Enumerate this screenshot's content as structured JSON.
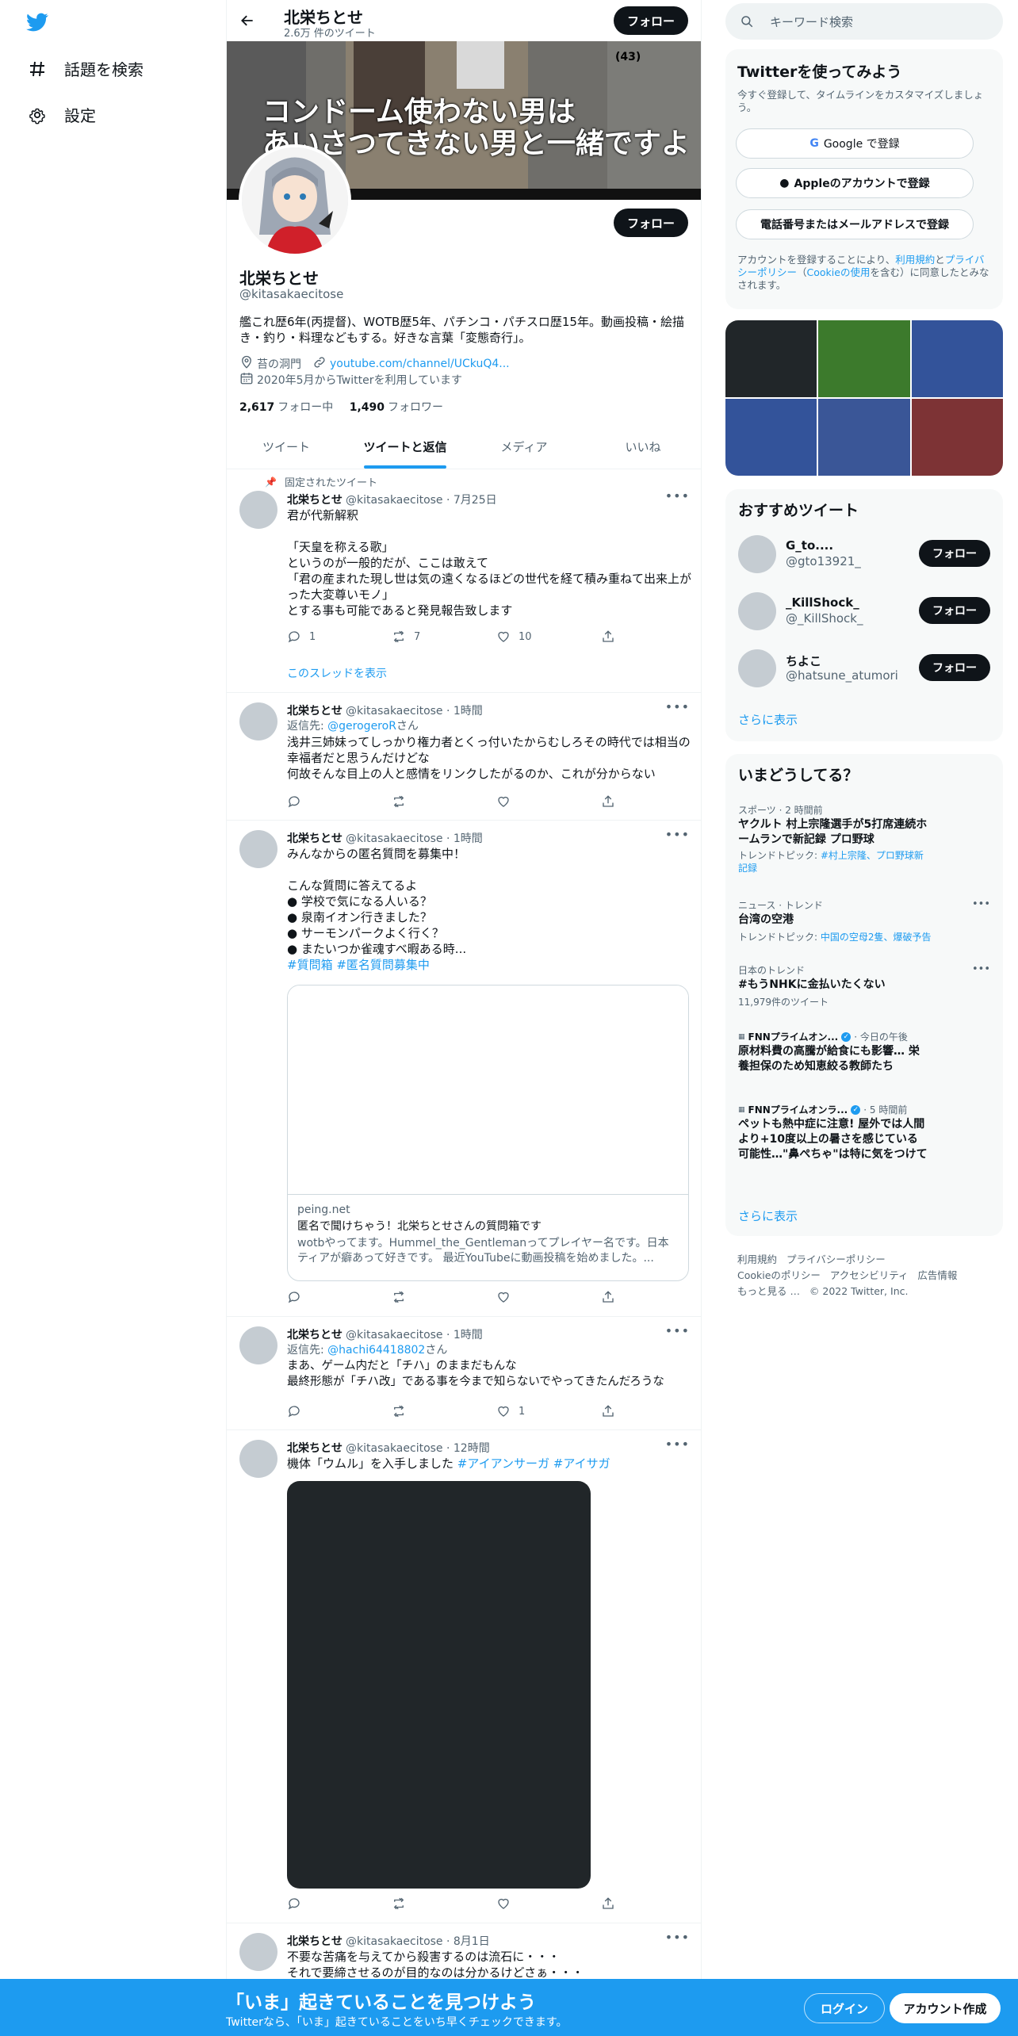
{
  "nav": {
    "explore_label": "話題を検索",
    "settings_label": "設定"
  },
  "header": {
    "name": "北栄ちとせ",
    "tweet_count": "2.6万 件のツイート",
    "follow_label": "フォロー"
  },
  "banner": {
    "caption_line1": "コンドーム使わない男は",
    "caption_line2": "あいさつてきない男と一緒ですよ",
    "tag": "(43)"
  },
  "profile": {
    "name": "北栄ちとせ",
    "handle": "@kitasakaecitose",
    "follow_label": "フォロー",
    "bio": "艦これ歴6年(丙提督)、WOTB歴5年、パチンコ・パチスロ歴15年。動画投稿・絵描き・釣り・料理などもする。好きな言葉「変態奇行」。",
    "location": "苔の洞門",
    "url": "youtube.com/channel/UCkuQ4...",
    "joined": "2020年5月からTwitterを利用しています",
    "following_count": "2,617",
    "following_label": "フォロー中",
    "followers_count": "1,490",
    "followers_label": "フォロワー"
  },
  "tabs": [
    {
      "label": "ツイート"
    },
    {
      "label": "ツイートと返信"
    },
    {
      "label": "メディア"
    },
    {
      "label": "いいね"
    }
  ],
  "tweets": [
    {
      "pinned_label": "固定されたツイート",
      "name": "北栄ちとせ",
      "handle": "@kitasakaecitose",
      "time": "· 7月25日",
      "lines": [
        "君が代新解釈",
        "",
        "「天皇を称える歌」",
        "というのが一般的だが、ここは敢えて",
        "「君の産まれた現し世は気の遠くなるほどの世代を経て積み重ねて出来上がった大変尊いモノ」",
        "とする事も可能であると発見報告致します"
      ],
      "replies": "1",
      "retweets": "7",
      "likes": "10",
      "thread_label": "このスレッドを表示"
    },
    {
      "name": "北栄ちとせ",
      "handle": "@kitasakaecitose",
      "time": "· 1時間",
      "reply_to_prefix": "返信先: ",
      "reply_to_user": "@gerogeroR",
      "reply_to_suffix": "さん",
      "lines": [
        "浅井三姉妹ってしっかり権力者とくっ付いたからむしろその時代では相当の幸福者だと思うんだけどな",
        "何故そんな目上の人と感情をリンクしたがるのか、これが分からない"
      ]
    },
    {
      "name": "北栄ちとせ",
      "handle": "@kitasakaecitose",
      "time": "· 1時間",
      "lines": [
        "みんなからの匿名質問を募集中！",
        "",
        "こんな質問に答えてるよ",
        "● 学校で気になる人いる？",
        "● 泉南イオン行きました？",
        "● サーモンパークよく行く？",
        "● またいつか雀魂すべ暇ある時..."
      ],
      "hashtags": "#質問箱 #匿名質問募集中",
      "card_domain": "peing.net",
      "card_title": "匿名で聞けちゃう！北栄ちとせさんの質問箱です",
      "card_desc": "wotbやってます。Hummel_the_Gentlemanってプレイヤー名です。日本ティアが癖あって好きです。 最近YouTubeに動画投稿を始めました。..."
    },
    {
      "name": "北栄ちとせ",
      "handle": "@kitasakaecitose",
      "time": "· 1時間",
      "reply_to_prefix": "返信先: ",
      "reply_to_user": "@hachi64418802",
      "reply_to_suffix": "さん",
      "lines": [
        "まあ、ゲーム内だと「チハ」のままだもんな",
        "最終形態が「チハ改」である事を今まで知らないでやってきたんだろうな"
      ],
      "likes": "1"
    },
    {
      "name": "北栄ちとせ",
      "handle": "@kitasakaecitose",
      "time": "· 12時間",
      "text": "機体「ウムル」を入手しました ",
      "hashtags": "#アイアンサーガ #アイサガ"
    },
    {
      "name": "北栄ちとせ",
      "handle": "@kitasakaecitose",
      "time": "· 8月1日",
      "lines": [
        "不要な苦痛を与えてから殺害するのは流石に・・・",
        "それで要締させるのが目的なのは分かるけどさぁ・・・"
      ]
    }
  ],
  "search": {
    "placeholder": "キーワード検索"
  },
  "signup": {
    "title": "Twitterを使ってみよう",
    "subtitle": "今すぐ登録して、タイムラインをカスタマイズしましょう。",
    "google": "Google で登録",
    "apple": "Appleのアカウントで登録",
    "phone": "電話番号またはメールアドレスで登録",
    "legal_1": "アカウントを登録することにより、",
    "legal_terms": "利用規約",
    "legal_2": "と",
    "legal_privacy": "プライバシーポリシー",
    "legal_3": "（",
    "legal_cookie": "Cookieの使用",
    "legal_4": "を含む）に同意したとみなされます。"
  },
  "media_grid_colors": [
    "#212629",
    "#3c7a2c",
    "#33539a",
    "#33539a",
    "#3a5697",
    "#7d3335"
  ],
  "recommended": {
    "title": "おすすめツイート",
    "users": [
      {
        "name": "G_to....",
        "handle": "@gto13921_"
      },
      {
        "name": "_KillShock_",
        "handle": "@_KillShock_"
      },
      {
        "name": "ちよこ",
        "handle": "@hatsune_atumori"
      }
    ],
    "follow_label": "フォロー",
    "more": "さらに表示"
  },
  "trends": {
    "title": "いまどうしてる？",
    "items": [
      {
        "meta": "スポーツ · 2 時間前",
        "title": "ヤクルト 村上宗隆選手が5打席連続ホームランで新記録 プロ野球",
        "sub_prefix": "トレンドトピック: ",
        "sub_links": "#村上宗隆、プロ野球新記録"
      },
      {
        "meta": "ニュース · トレンド",
        "title": "台湾の空港",
        "sub_prefix": "トレンドトピック: ",
        "sub_links": "中国の空母2隻、爆破予告"
      },
      {
        "meta": "日本のトレンド",
        "title": "#もうNHKに金払いたくない",
        "sub_plain": "11,979件のツイート"
      },
      {
        "source": "FNNプライムオン...",
        "meta": "· 今日の午後",
        "title": "原材料費の高騰が給食にも影響… 栄養担保のため知恵絞る教師たち"
      },
      {
        "source": "FNNプライムオンラ...",
        "meta": "· 5 時間前",
        "title": "ペットも熱中症に注意! 屋外では人間より+10度以上の暑さを感じている可能性…\"鼻ぺちゃ\"は特に気をつけて"
      }
    ],
    "more": "さらに表示"
  },
  "footer": {
    "line1": [
      "利用規約",
      "プライバシーポリシー"
    ],
    "line2": [
      "Cookieのポリシー",
      "アクセシビリティ",
      "広告情報"
    ],
    "line3": [
      "もっと見る …",
      "© 2022 Twitter, Inc."
    ]
  },
  "bottom_bar": {
    "title": "「いま」起きていることを見つけよう",
    "subtitle": "Twitterなら、「いま」起きていることをいち早くチェックできます。",
    "login": "ログイン",
    "signup": "アカウント作成"
  },
  "colors": {
    "accent": "#1d9bf0",
    "dark": "#0f1419",
    "muted": "#536471"
  }
}
